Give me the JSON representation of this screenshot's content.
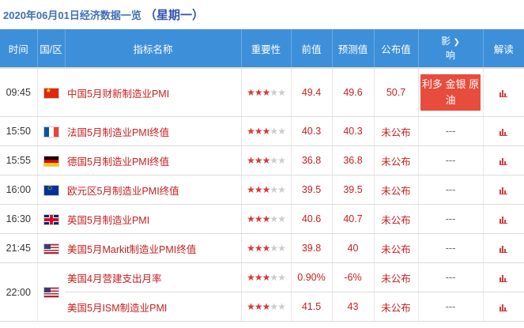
{
  "header": {
    "date_title": "2020年06月01日经济数据一览",
    "weekday": "（星期一）"
  },
  "columns": {
    "time": "时间",
    "region": "国/区",
    "indicator": "指标名称",
    "importance": "重要性",
    "previous": "前值",
    "forecast": "预测值",
    "actual": "公布值",
    "impact_line1": "影",
    "impact_line2": "响",
    "interpret": "解读"
  },
  "icons": {
    "impact_dropdown": "chevron-down-icon",
    "interpret": "bar-chart-icon"
  },
  "colors": {
    "header_bg": "#3d8fd9",
    "indicator_text": "#c81e1e",
    "impact_badge": "#e84c3d",
    "star_active": "#d43a3a",
    "star_inactive": "#cccccc"
  },
  "rows": [
    {
      "time": "09:45",
      "flag": "china-flag-icon",
      "indicator": "中国5月财新制造业PMI",
      "importance": 3,
      "previous": "49.4",
      "forecast": "49.6",
      "actual": "50.7",
      "impact": "利多 金银 原油"
    },
    {
      "time": "15:50",
      "flag": "france-flag-icon",
      "indicator": "法国5月制造业PMI终值",
      "importance": 3,
      "previous": "40.3",
      "forecast": "40.3",
      "actual": "未公布",
      "impact": "---"
    },
    {
      "time": "15:55",
      "flag": "germany-flag-icon",
      "indicator": "德国5月制造业PMI终值",
      "importance": 3,
      "previous": "36.8",
      "forecast": "36.8",
      "actual": "未公布",
      "impact": "---"
    },
    {
      "time": "16:00",
      "flag": "eu-flag-icon",
      "indicator": "欧元区5月制造业PMI终值",
      "importance": 3,
      "previous": "39.5",
      "forecast": "39.5",
      "actual": "未公布",
      "impact": "---"
    },
    {
      "time": "16:30",
      "flag": "uk-flag-icon",
      "indicator": "英国5月制造业PMI",
      "importance": 3,
      "previous": "40.6",
      "forecast": "40.7",
      "actual": "未公布",
      "impact": "---"
    },
    {
      "time": "21:45",
      "flag": "us-flag-icon",
      "indicator": "美国5月Markit制造业PMI终值",
      "importance": 3,
      "previous": "39.8",
      "forecast": "40",
      "actual": "未公布",
      "impact": "---"
    },
    {
      "time": "22:00",
      "flag": "us-flag-icon",
      "indicator": "美国4月营建支出月率",
      "importance": 3,
      "previous": "0.90%",
      "forecast": "-6%",
      "actual": "未公布",
      "impact": "---"
    },
    {
      "time": "",
      "flag": "",
      "indicator": "美国5月ISM制造业PMI",
      "importance": 3,
      "previous": "41.5",
      "forecast": "43",
      "actual": "未公布",
      "impact": "---"
    }
  ]
}
